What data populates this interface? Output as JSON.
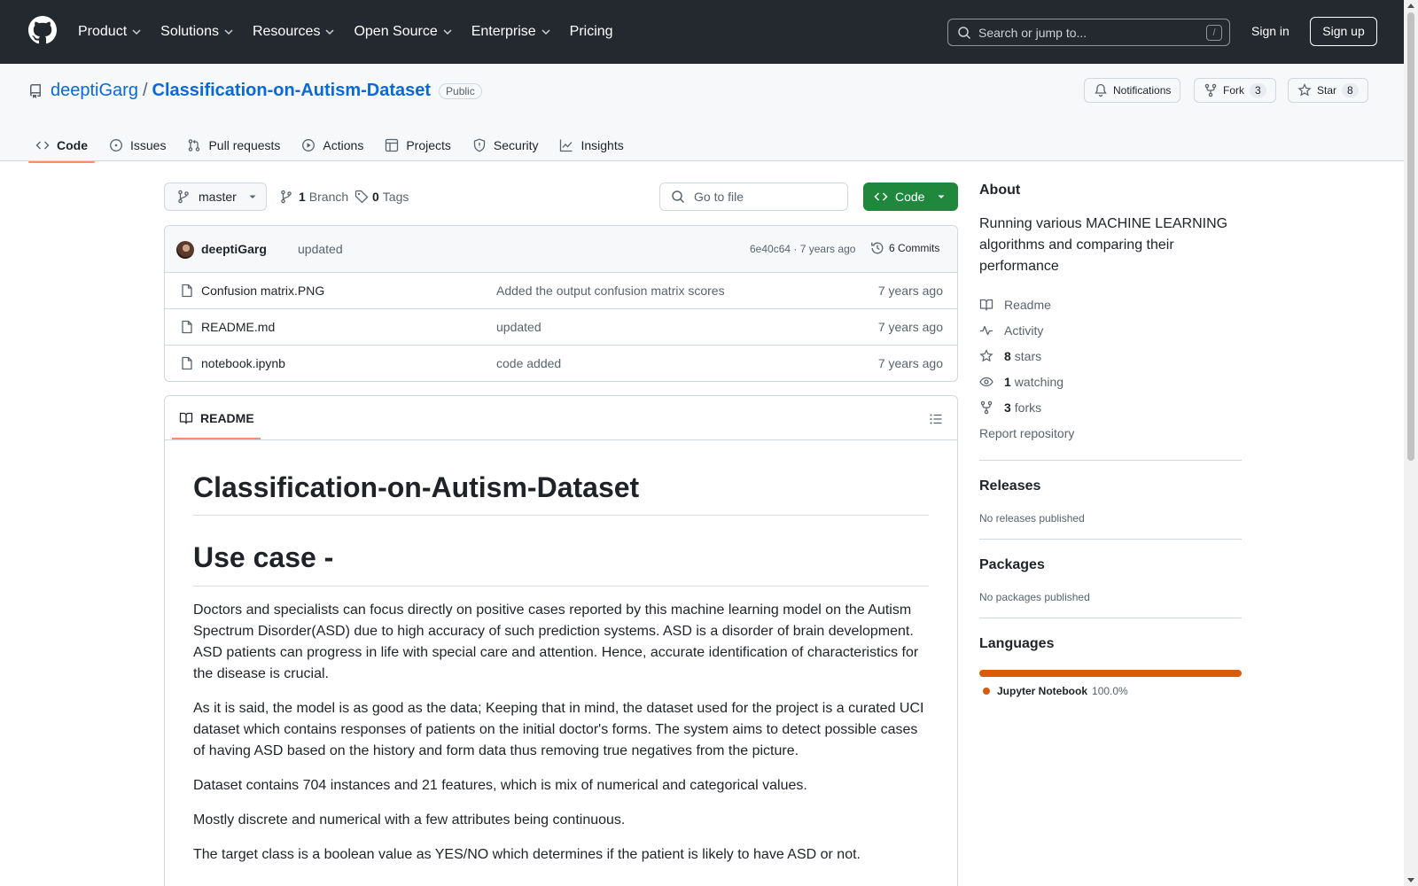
{
  "header": {
    "nav": [
      "Product",
      "Solutions",
      "Resources",
      "Open Source",
      "Enterprise",
      "Pricing"
    ],
    "search_placeholder": "Search or jump to...",
    "search_key": "/",
    "sign_in": "Sign in",
    "sign_up": "Sign up"
  },
  "repo": {
    "owner": "deeptiGarg",
    "separator": "/",
    "name": "Classification-on-Autism-Dataset",
    "visibility": "Public",
    "notifications_label": "Notifications",
    "fork_label": "Fork",
    "fork_count": "3",
    "star_label": "Star",
    "star_count": "8"
  },
  "tabs": [
    "Code",
    "Issues",
    "Pull requests",
    "Actions",
    "Projects",
    "Security",
    "Insights"
  ],
  "toolbar": {
    "branch": "master",
    "branches_count": "1",
    "branches_label": "Branch",
    "tags_count": "0",
    "tags_label": "Tags",
    "goto_placeholder": "Go to file",
    "code_button": "Code"
  },
  "commit": {
    "author": "deeptiGarg",
    "message": "updated",
    "meta": "6e40c64 · 7 years ago",
    "count_label": "6 Commits"
  },
  "files": [
    {
      "name": "Confusion matrix.PNG",
      "message": "Added the output confusion matrix scores",
      "time": "7 years ago"
    },
    {
      "name": "README.md",
      "message": "updated",
      "time": "7 years ago"
    },
    {
      "name": "notebook.ipynb",
      "message": "code added",
      "time": "7 years ago"
    }
  ],
  "readme": {
    "tab": "README",
    "h1": "Classification-on-Autism-Dataset",
    "h2": "Use case -",
    "p1": "Doctors and specialists can focus directly on positive cases reported by this machine learning model on the Autism Spectrum Disorder(ASD) due to high accuracy of such prediction systems. ASD is a disorder of brain development. ASD patients can progress in life with special care and attention. Hence, accurate identification of characteristics for the disease is crucial.",
    "p2": "As it is said, the model is as good as the data; Keeping that in mind, the dataset used for the project is a curated UCI dataset which contains responses of patients on the initial doctor's forms. The system aims to detect possible cases of having ASD based on the history and form data thus removing true negatives from the picture.",
    "p3": "Dataset contains 704 instances and 21 features, which is mix of numerical and categorical values.",
    "p4": "Mostly discrete and numerical with a few attributes being continuous.",
    "p5": "The target class is a boolean value as YES/NO which determines if the patient is likely to have ASD or not."
  },
  "sidebar": {
    "about_title": "About",
    "about_desc": "Running various MACHINE LEARNING algorithms and comparing their performance",
    "readme_link": "Readme",
    "activity_link": "Activity",
    "stars_count": "8",
    "stars_label": "stars",
    "watching_count": "1",
    "watching_label": "watching",
    "forks_count": "3",
    "forks_label": "forks",
    "report_link": "Report repository",
    "releases_title": "Releases",
    "releases_note": "No releases published",
    "packages_title": "Packages",
    "packages_note": "No packages published",
    "languages_title": "Languages",
    "language_name": "Jupyter Notebook",
    "language_pct": "100.0%",
    "language_color": "#DA5B0B"
  },
  "colors": {
    "header_bg": "#24292f",
    "link": "#0969da",
    "primary_button": "#1f883d",
    "active_tab_underline": "#fd8c73"
  }
}
